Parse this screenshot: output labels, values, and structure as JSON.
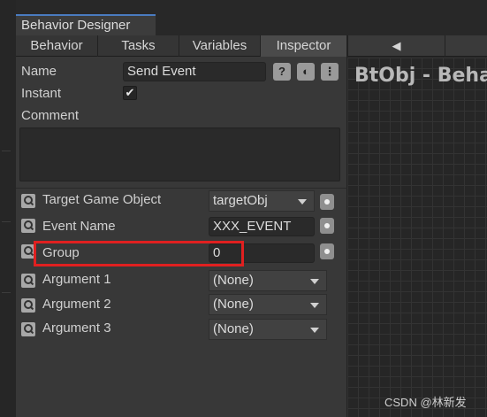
{
  "window": {
    "title": "Behavior Designer"
  },
  "tabs": [
    {
      "label": "Behavior"
    },
    {
      "label": "Tasks"
    },
    {
      "label": "Variables"
    },
    {
      "label": "Inspector",
      "active": true
    }
  ],
  "nav": {
    "back_icon": "left-arrow-icon"
  },
  "inspector": {
    "name_label": "Name",
    "name_value": "Send Event",
    "instant_label": "Instant",
    "instant_checked": true,
    "comment_label": "Comment",
    "comment_value": "",
    "header_buttons": {
      "help": "?",
      "toggle": "◐",
      "menu": "⋮"
    },
    "fields": [
      {
        "label": "Target Game Object",
        "value": "targetObj",
        "kind": "dropdown"
      },
      {
        "label": "Event Name",
        "value": "XXX_EVENT",
        "kind": "text"
      },
      {
        "label": "Group",
        "value": "0",
        "kind": "text"
      },
      {
        "label": "Argument 1",
        "value": "(None)",
        "kind": "dropdown"
      },
      {
        "label": "Argument 2",
        "value": "(None)",
        "kind": "dropdown"
      },
      {
        "label": "Argument 3",
        "value": "(None)",
        "kind": "dropdown"
      }
    ]
  },
  "graph": {
    "title": "BtObj - Beha"
  },
  "watermark": "CSDN @林新发",
  "colors": {
    "highlight": "#e02020",
    "accent": "#4a7bbf"
  }
}
